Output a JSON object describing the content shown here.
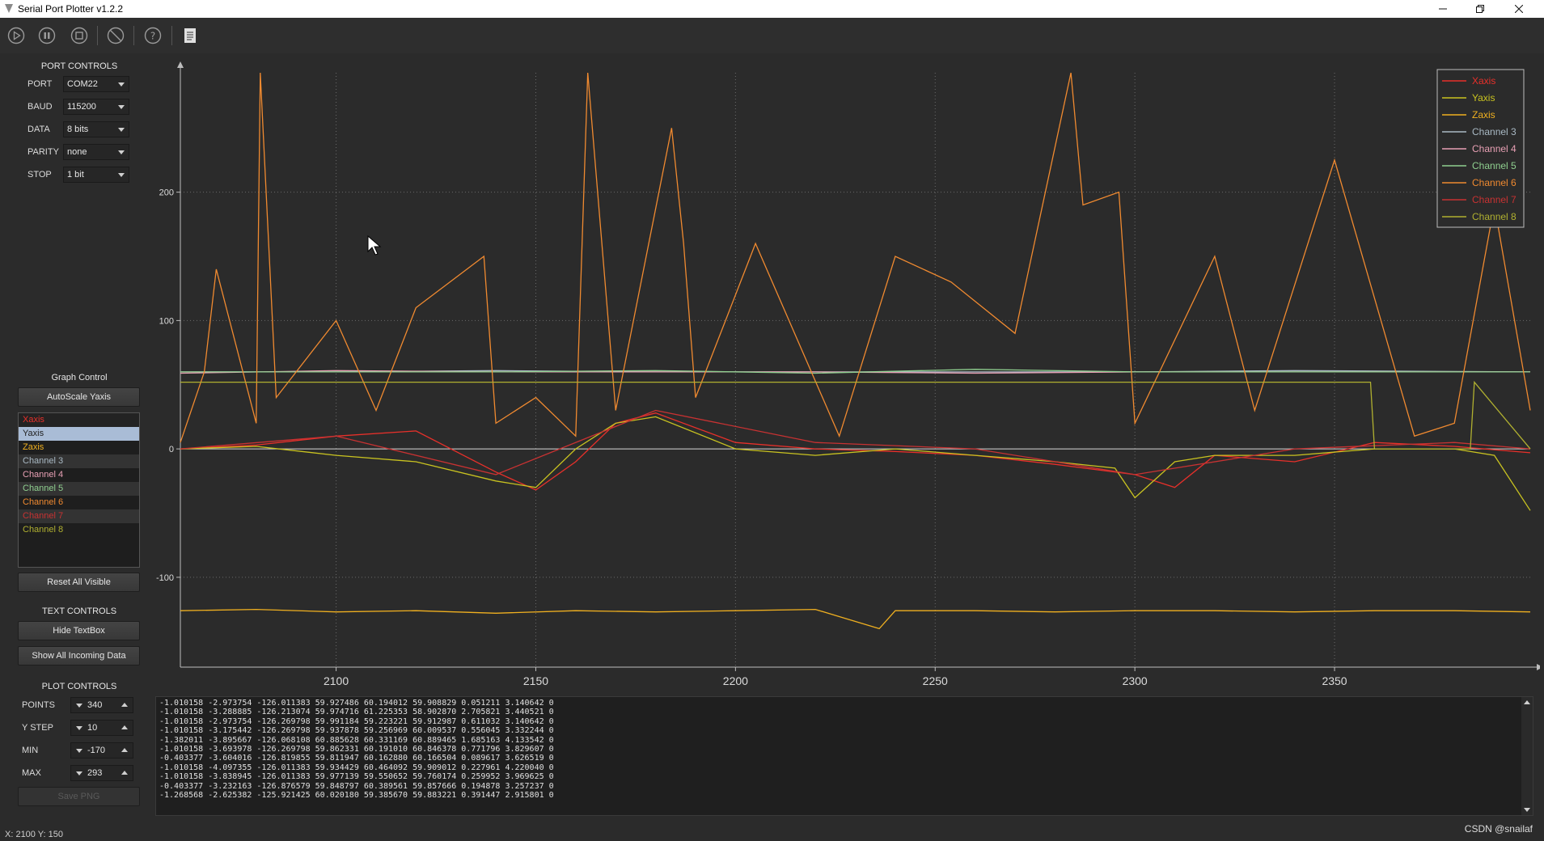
{
  "window": {
    "title": "Serial Port Plotter v1.2.2"
  },
  "toolbar": {
    "icons": [
      "play-icon",
      "pause-icon",
      "stop-icon",
      "clear-icon",
      "help-icon",
      "document-icon"
    ]
  },
  "port_controls": {
    "title": "PORT CONTROLS",
    "rows": [
      {
        "label": "PORT",
        "value": "COM22"
      },
      {
        "label": "BAUD",
        "value": "115200"
      },
      {
        "label": "DATA",
        "value": "8 bits"
      },
      {
        "label": "PARITY",
        "value": "none"
      },
      {
        "label": "STOP",
        "value": "1 bit"
      }
    ]
  },
  "graph_control": {
    "title": "Graph Control",
    "autoscale_label": "AutoScale Yaxis",
    "reset_label": "Reset All Visible",
    "channels": [
      {
        "name": "Xaxis",
        "color": "#e8302a",
        "selected": false
      },
      {
        "name": "Yaxis",
        "color": "#c9c320",
        "selected": true
      },
      {
        "name": "Zaxis",
        "color": "#f0b020",
        "selected": false
      },
      {
        "name": "Channel 3",
        "color": "#a9b9c4",
        "selected": false
      },
      {
        "name": "Channel 4",
        "color": "#e8a0b4",
        "selected": false
      },
      {
        "name": "Channel 5",
        "color": "#8fcf8f",
        "selected": false
      },
      {
        "name": "Channel 6",
        "color": "#f08a30",
        "selected": false
      },
      {
        "name": "Channel 7",
        "color": "#c83232",
        "selected": false
      },
      {
        "name": "Channel 8",
        "color": "#b0b030",
        "selected": false
      }
    ]
  },
  "text_controls": {
    "title": "TEXT CONTROLS",
    "hide_label": "Hide TextBox",
    "show_all_label": "Show All Incoming Data"
  },
  "plot_controls": {
    "title": "PLOT CONTROLS",
    "rows": [
      {
        "label": "POINTS",
        "value": "340"
      },
      {
        "label": "Y STEP",
        "value": "10"
      },
      {
        "label": "MIN",
        "value": "-170"
      },
      {
        "label": "MAX",
        "value": "293"
      }
    ],
    "save_label": "Save PNG"
  },
  "textbox": {
    "lines": [
      "-1.010158 -2.973754 -126.011383 59.927486 60.194012 59.908829 0.051211 3.140642 0",
      "-1.010158 -3.288885 -126.213074 59.974716 61.225353 58.902870 2.705821 3.440521 0",
      "-1.010158 -2.973754 -126.269798 59.991184 59.223221 59.912987 0.611032 3.140642 0",
      "-1.010158 -3.175442 -126.269798 59.937878 59.256969 60.009537 0.556045 3.332244 0",
      "-1.382011 -3.895667 -126.068108 60.885628 60.331169 60.889465 1.685163 4.133542 0",
      "-1.010158 -3.693978 -126.269798 59.862331 60.191010 60.846378 0.771796 3.829607 0",
      "-0.403377 -3.604016 -126.819855 59.811947 60.162880 60.166504 0.089617 3.626519 0",
      "-1.010158 -4.097355 -126.011383 59.934429 60.464092 59.909012 0.227961 4.220040 0",
      "-1.010158 -3.838945 -126.011383 59.977139 59.550652 59.760174 0.259952 3.969625 0",
      "-0.403377 -3.232163 -126.876579 59.848797 60.389561 59.857666 0.194878 3.257237 0",
      "-1.268568 -2.625382 -125.921425 60.020180 59.385670 59.883221 0.391447 2.915801 0"
    ]
  },
  "statusbar": {
    "coords": "X: 2100 Y: 150",
    "watermark": "CSDN @snailaf"
  },
  "chart_data": {
    "type": "line",
    "x_ticks": [
      2100,
      2150,
      2200,
      2250,
      2300,
      2350
    ],
    "y_ticks": [
      -100,
      0,
      100,
      200
    ],
    "xlim": [
      2061,
      2399
    ],
    "ylim": [
      -170,
      293
    ],
    "grid": true,
    "legend_position": "top-right",
    "series": [
      {
        "name": "Xaxis",
        "color": "#e8302a"
      },
      {
        "name": "Yaxis",
        "color": "#c9c320"
      },
      {
        "name": "Zaxis",
        "color": "#f0b020"
      },
      {
        "name": "Channel 3",
        "color": "#a9b9c4"
      },
      {
        "name": "Channel 4",
        "color": "#e8a0b4"
      },
      {
        "name": "Channel 5",
        "color": "#8fcf8f"
      },
      {
        "name": "Channel 6",
        "color": "#f08a30"
      },
      {
        "name": "Channel 7",
        "color": "#c83232"
      },
      {
        "name": "Channel 8",
        "color": "#b0b030"
      }
    ],
    "lines_approx": [
      {
        "series": "Xaxis",
        "x": [
          2061,
          2080,
          2100,
          2120,
          2140,
          2150,
          2160,
          2170,
          2180,
          2200,
          2220,
          2240,
          2260,
          2280,
          2300,
          2310,
          2320,
          2340,
          2360,
          2380,
          2399
        ],
        "y": [
          0,
          3,
          10,
          14,
          -18,
          -32,
          -10,
          20,
          28,
          5,
          0,
          -2,
          -5,
          -12,
          -20,
          -30,
          -5,
          -10,
          5,
          2,
          -3
        ]
      },
      {
        "series": "Yaxis",
        "x": [
          2061,
          2080,
          2100,
          2120,
          2140,
          2150,
          2160,
          2170,
          2180,
          2200,
          2220,
          2240,
          2260,
          2280,
          2295,
          2300,
          2310,
          2320,
          2340,
          2360,
          2380,
          2390,
          2399
        ],
        "y": [
          0,
          2,
          -5,
          -10,
          -25,
          -30,
          0,
          20,
          25,
          0,
          -5,
          0,
          -5,
          -10,
          -15,
          -38,
          -10,
          -5,
          -5,
          0,
          0,
          -5,
          -48
        ]
      },
      {
        "series": "Zaxis",
        "x": [
          2061,
          2080,
          2100,
          2120,
          2140,
          2160,
          2180,
          2200,
          2220,
          2236,
          2240,
          2260,
          2280,
          2300,
          2320,
          2340,
          2360,
          2380,
          2399
        ],
        "y": [
          -126,
          -125,
          -127,
          -126,
          -128,
          -126,
          -127,
          -126,
          -125,
          -140,
          -126,
          -126,
          -127,
          -126,
          -126,
          -127,
          -126,
          -126,
          -127
        ]
      },
      {
        "series": "Channel 3",
        "x": [
          2061,
          2100,
          2140,
          2180,
          2220,
          2260,
          2300,
          2340,
          2399
        ],
        "y": [
          60,
          60,
          61,
          60,
          60,
          60,
          60,
          61,
          60
        ]
      },
      {
        "series": "Channel 4",
        "x": [
          2061,
          2100,
          2140,
          2180,
          2220,
          2260,
          2300,
          2340,
          2399
        ],
        "y": [
          59,
          61,
          60,
          60,
          60,
          59,
          60,
          60,
          60
        ]
      },
      {
        "series": "Channel 5",
        "x": [
          2061,
          2100,
          2140,
          2180,
          2220,
          2260,
          2300,
          2340,
          2399
        ],
        "y": [
          60,
          60,
          60,
          61,
          59,
          62,
          60,
          60,
          60
        ]
      },
      {
        "series": "Channel 6",
        "x": [
          2061,
          2067,
          2070,
          2080,
          2081,
          2085,
          2100,
          2110,
          2120,
          2137,
          2140,
          2150,
          2160,
          2163,
          2170,
          2184,
          2187,
          2190,
          2205,
          2226,
          2240,
          2254,
          2270,
          2284,
          2287,
          2296,
          2300,
          2320,
          2330,
          2350,
          2370,
          2380,
          2390,
          2399
        ],
        "y": [
          5,
          60,
          140,
          20,
          293,
          40,
          100,
          30,
          110,
          150,
          20,
          40,
          10,
          293,
          30,
          250,
          160,
          40,
          160,
          10,
          150,
          130,
          90,
          293,
          190,
          200,
          20,
          150,
          30,
          225,
          10,
          20,
          190,
          30
        ]
      },
      {
        "series": "Channel 7",
        "x": [
          2061,
          2100,
          2140,
          2180,
          2220,
          2260,
          2300,
          2340,
          2380,
          2399
        ],
        "y": [
          0,
          10,
          -20,
          30,
          5,
          0,
          -20,
          0,
          5,
          0
        ]
      },
      {
        "series": "Channel 8",
        "x": [
          2061,
          2359,
          2360,
          2384,
          2385,
          2399
        ],
        "y": [
          52,
          52,
          0,
          0,
          52,
          0
        ]
      }
    ]
  }
}
